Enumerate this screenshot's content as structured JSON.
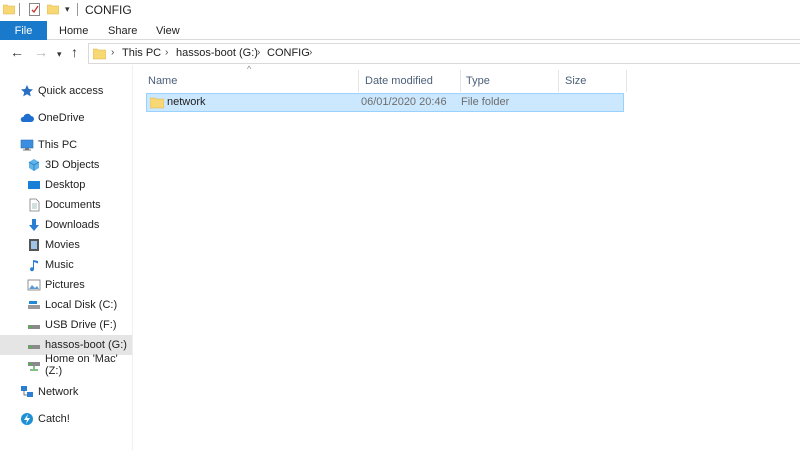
{
  "window": {
    "title": "CONFIG"
  },
  "ribbon": {
    "file": "File",
    "tabs": [
      "Home",
      "Share",
      "View"
    ]
  },
  "address": {
    "crumbs": [
      "This PC",
      "hassos-boot (G:)",
      "CONFIG"
    ]
  },
  "navpane": {
    "items": [
      {
        "label": "Quick access",
        "icon": "star-icon"
      },
      {
        "label": "OneDrive",
        "icon": "cloud-icon"
      },
      {
        "label": "This PC",
        "icon": "monitor-icon"
      },
      {
        "label": "3D Objects",
        "icon": "cube-icon"
      },
      {
        "label": "Desktop",
        "icon": "desktop-icon"
      },
      {
        "label": "Documents",
        "icon": "document-icon"
      },
      {
        "label": "Downloads",
        "icon": "download-arrow-icon"
      },
      {
        "label": "Movies",
        "icon": "film-icon"
      },
      {
        "label": "Music",
        "icon": "music-note-icon"
      },
      {
        "label": "Pictures",
        "icon": "picture-icon"
      },
      {
        "label": "Local Disk (C:)",
        "icon": "local-disk-icon"
      },
      {
        "label": "USB Drive (F:)",
        "icon": "usb-drive-icon"
      },
      {
        "label": "hassos-boot (G:)",
        "icon": "drive-icon",
        "selected": true
      },
      {
        "label": "Home on 'Mac' (Z:)",
        "icon": "network-drive-icon"
      },
      {
        "label": "Network",
        "icon": "network-icon"
      },
      {
        "label": "Catch!",
        "icon": "catch-icon"
      }
    ]
  },
  "filelist": {
    "columns": [
      "Name",
      "Date modified",
      "Type",
      "Size"
    ],
    "rows": [
      {
        "name": "network",
        "date": "06/01/2020 20:46",
        "type": "File folder",
        "size": ""
      }
    ]
  },
  "colors": {
    "accent": "#1979ca",
    "selection": "#cce8ff",
    "selection_border": "#99d1ff",
    "folder": "#f8d775"
  }
}
